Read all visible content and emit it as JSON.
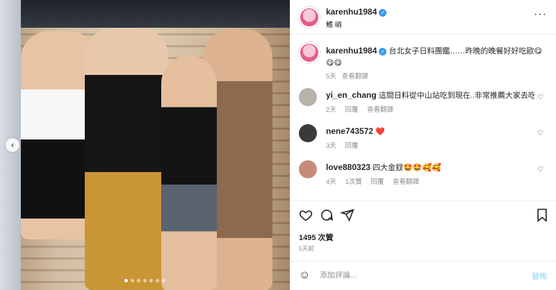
{
  "header": {
    "username": "karenhu1984",
    "location": "鰭 峭",
    "more_icon": "more-horizontal-icon"
  },
  "caption": {
    "username": "karenhu1984",
    "text": "台北女子日料團鑑……昨晚的晚餐好好吃歐😋😋😋",
    "time": "5天",
    "reply": "查看翻譯"
  },
  "comments": [
    {
      "username": "yi_en_chang",
      "text": "這間日料從中山站吃到現在..非常推薦大家去吃👍",
      "time": "2天",
      "reply": "回覆",
      "translate": "查看翻譯",
      "avatar_color": "#b7b2aa"
    },
    {
      "username": "nene743572",
      "text": "❤️",
      "time": "3天",
      "reply": "回覆",
      "translate": "",
      "avatar_color": "#3a3a3a"
    },
    {
      "username": "love880323",
      "text": "四大金釵🤩🤩🥰🥰",
      "time": "4天",
      "likes": "1次贊",
      "reply": "回覆",
      "translate": "查看翻譯",
      "avatar_color": "#c78b7a"
    }
  ],
  "actions": {
    "like_icon": "heart-icon",
    "comment_icon": "comment-icon",
    "share_icon": "send-icon",
    "save_icon": "bookmark-icon"
  },
  "likes_text": "1495 次贊",
  "post_date": "5天前",
  "add_comment": {
    "placeholder": "添加評論...",
    "post_label": "發佈"
  },
  "carousel": {
    "current": 1,
    "total": 7
  }
}
